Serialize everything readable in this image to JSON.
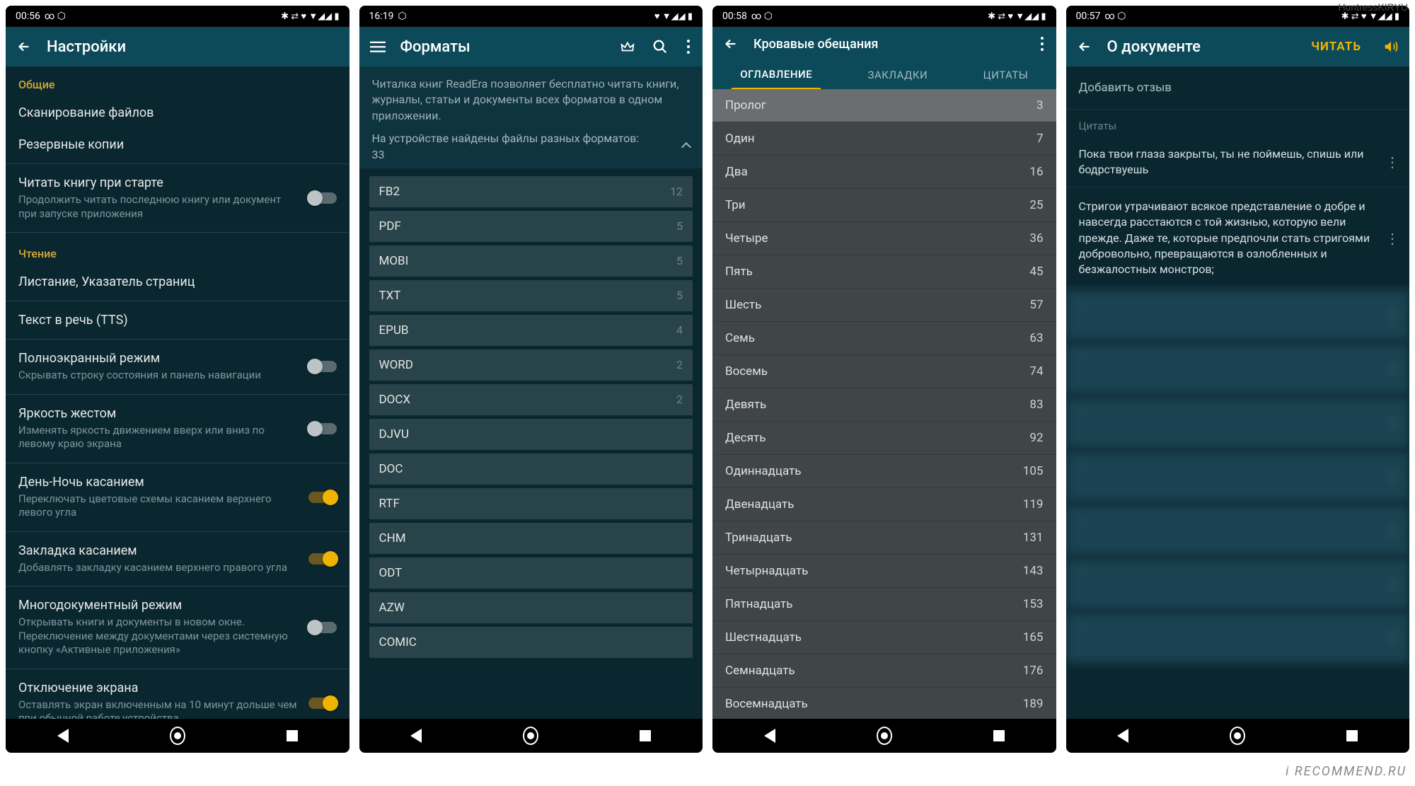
{
  "watermark_top": "HuntressKIRYU",
  "watermark_bottom": "i RECOMMEND.RU",
  "nav": {
    "back": "◀",
    "home": "●",
    "recent": "■"
  },
  "status_icons": "✱ ⇄ ♥ ▼◢◢ ▮",
  "screen1": {
    "time": "00:56",
    "status_extra": "∞  ⬡",
    "title": "Настройки",
    "sections": [
      {
        "header": "Общие",
        "items": [
          {
            "title": "Сканирование файлов",
            "sub": "",
            "toggle": null
          },
          {
            "title": "Резервные копии",
            "sub": "",
            "toggle": null
          },
          {
            "title": "Читать книгу при старте",
            "sub": "Продолжить читать последнюю книгу или документ при запуске приложения",
            "toggle": false
          }
        ]
      },
      {
        "header": "Чтение",
        "items": [
          {
            "title": "Листание, Указатель страниц",
            "sub": "",
            "toggle": null
          },
          {
            "title": "Текст в речь (TTS)",
            "sub": "",
            "toggle": null
          },
          {
            "title": "Полноэкранный режим",
            "sub": "Скрывать строку состояния и панель навигации",
            "toggle": false
          },
          {
            "title": "Яркость жестом",
            "sub": "Изменять яркость движением вверх или вниз по левому краю экрана",
            "toggle": false
          },
          {
            "title": "День-Ночь касанием",
            "sub": "Переключать цветовые схемы касанием верхнего левого угла",
            "toggle": true
          },
          {
            "title": "Закладка касанием",
            "sub": "Добавлять закладку касанием верхнего правого угла",
            "toggle": true
          },
          {
            "title": "Многодокументный режим",
            "sub": "Открывать книги и документы в новом окне. Переключение между документами через системную кнопку «Активные приложения»",
            "toggle": false
          },
          {
            "title": "Отключение экрана",
            "sub": "Оставлять экран включенным на 10 минут дольше чем при обычной работе устройства",
            "toggle": true
          }
        ]
      }
    ]
  },
  "screen2": {
    "time": "16:19",
    "status_extra": "⬡",
    "title": "Форматы",
    "info": "Читалка книг ReadEra позволяет бесплатно читать книги, журналы, статьи и документы всех форматов в одном приложении.",
    "info2": "На устройстве найдены файлы разных форматов:",
    "count": "33",
    "formats": [
      {
        "name": "FB2",
        "count": "12"
      },
      {
        "name": "PDF",
        "count": "5"
      },
      {
        "name": "MOBI",
        "count": "5"
      },
      {
        "name": "TXT",
        "count": "5"
      },
      {
        "name": "EPUB",
        "count": "4"
      },
      {
        "name": "WORD",
        "count": "2"
      },
      {
        "name": "DOCX",
        "count": "2"
      },
      {
        "name": "DJVU",
        "count": ""
      },
      {
        "name": "DOC",
        "count": ""
      },
      {
        "name": "RTF",
        "count": ""
      },
      {
        "name": "CHM",
        "count": ""
      },
      {
        "name": "ODT",
        "count": ""
      },
      {
        "name": "AZW",
        "count": ""
      },
      {
        "name": "COMIC",
        "count": ""
      }
    ]
  },
  "screen3": {
    "time": "00:58",
    "status_extra": "∞  ⬡",
    "title": "Кровавые обещания",
    "tabs": [
      "ОГЛАВЛЕНИЕ",
      "ЗАКЛАДКИ",
      "ЦИТАТЫ"
    ],
    "active_tab": 0,
    "toc": [
      {
        "title": "Пролог",
        "page": "3",
        "active": true
      },
      {
        "title": "Один",
        "page": "7"
      },
      {
        "title": "Два",
        "page": "16"
      },
      {
        "title": "Три",
        "page": "25"
      },
      {
        "title": "Четыре",
        "page": "36"
      },
      {
        "title": "Пять",
        "page": "45"
      },
      {
        "title": "Шесть",
        "page": "57"
      },
      {
        "title": "Семь",
        "page": "63"
      },
      {
        "title": "Восемь",
        "page": "74"
      },
      {
        "title": "Девять",
        "page": "83"
      },
      {
        "title": "Десять",
        "page": "92"
      },
      {
        "title": "Одиннадцать",
        "page": "105"
      },
      {
        "title": "Двенадцать",
        "page": "119"
      },
      {
        "title": "Тринадцать",
        "page": "131"
      },
      {
        "title": "Четырнадцать",
        "page": "143"
      },
      {
        "title": "Пятнадцать",
        "page": "153"
      },
      {
        "title": "Шестнадцать",
        "page": "165"
      },
      {
        "title": "Семнадцать",
        "page": "176"
      },
      {
        "title": "Восемнадцать",
        "page": "189"
      }
    ]
  },
  "screen4": {
    "time": "00:57",
    "status_extra": "∞  ⬡",
    "title": "О документе",
    "read_btn": "ЧИТАТЬ",
    "review": "Добавить отзыв",
    "quotes_label": "Цитаты",
    "quotes": [
      {
        "text": "Пока твои глаза закрыты, ты не поймешь, спишь или бодрствуешь",
        "blurred": false
      },
      {
        "text": "Стригои утрачивают всякое представление о добре и навсегда расстаются с той жизнью, которую вели прежде. Даже те, которые предпочли стать стригоями добровольно, превращаются в озлобленных и безжалостных монстров;",
        "blurred": false
      },
      {
        "text": "",
        "blurred": true
      },
      {
        "text": "",
        "blurred": true
      },
      {
        "text": "",
        "blurred": true
      },
      {
        "text": "",
        "blurred": true
      },
      {
        "text": "",
        "blurred": true
      },
      {
        "text": "",
        "blurred": true
      },
      {
        "text": "",
        "blurred": true
      }
    ]
  }
}
